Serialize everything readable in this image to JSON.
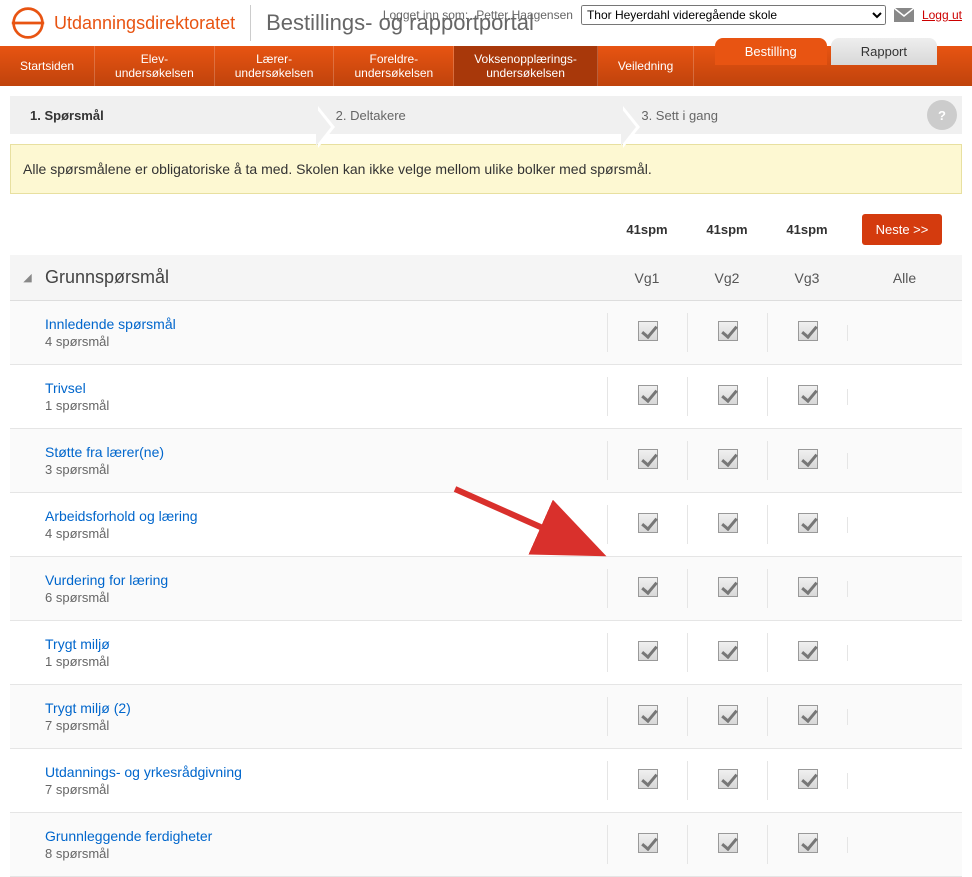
{
  "header": {
    "org_name": "Utdanningsdirektoratet",
    "portal_title": "Bestillings- og rapportportal",
    "login_label": "Logget inn som:",
    "user_name": "Petter Haagensen",
    "school_selected": "Thor Heyerdahl videregående skole",
    "logout": "Logg ut"
  },
  "tabs": {
    "bestilling": "Bestilling",
    "rapport": "Rapport"
  },
  "nav": {
    "startsiden": "Startsiden",
    "elev": "Elev-\nundersøkelsen",
    "laerer": "Lærer-\nundersøkelsen",
    "foreldre": "Foreldre-\nundersøkelsen",
    "voksen": "Voksenopplærings-\nundersøkelsen",
    "veiledning": "Veiledning"
  },
  "steps": {
    "s1": "1. Spørsmål",
    "s2": "2. Deltakere",
    "s3": "3. Sett i gang"
  },
  "banner": "Alle spørsmålene er obligatoriske å ta med. Skolen kan ikke velge mellom ulike bolker med spørsmål.",
  "columns": {
    "spm_count": "41spm",
    "vg1": "Vg1",
    "vg2": "Vg2",
    "vg3": "Vg3",
    "alle": "Alle"
  },
  "next_button": "Neste >>",
  "groups_title": "Grunnspørsmål",
  "questions": [
    {
      "title": "Innledende spørsmål",
      "count": "4 spørsmål"
    },
    {
      "title": "Trivsel",
      "count": "1 spørsmål"
    },
    {
      "title": "Støtte fra lærer(ne)",
      "count": "3 spørsmål"
    },
    {
      "title": "Arbeidsforhold og læring",
      "count": "4 spørsmål"
    },
    {
      "title": "Vurdering for læring",
      "count": "6 spørsmål"
    },
    {
      "title": "Trygt miljø",
      "count": "1 spørsmål"
    },
    {
      "title": "Trygt miljø (2)",
      "count": "7 spørsmål"
    },
    {
      "title": "Utdannings- og yrkesrådgivning",
      "count": "7 spørsmål"
    },
    {
      "title": "Grunnleggende ferdigheter",
      "count": "8 spørsmål"
    }
  ]
}
